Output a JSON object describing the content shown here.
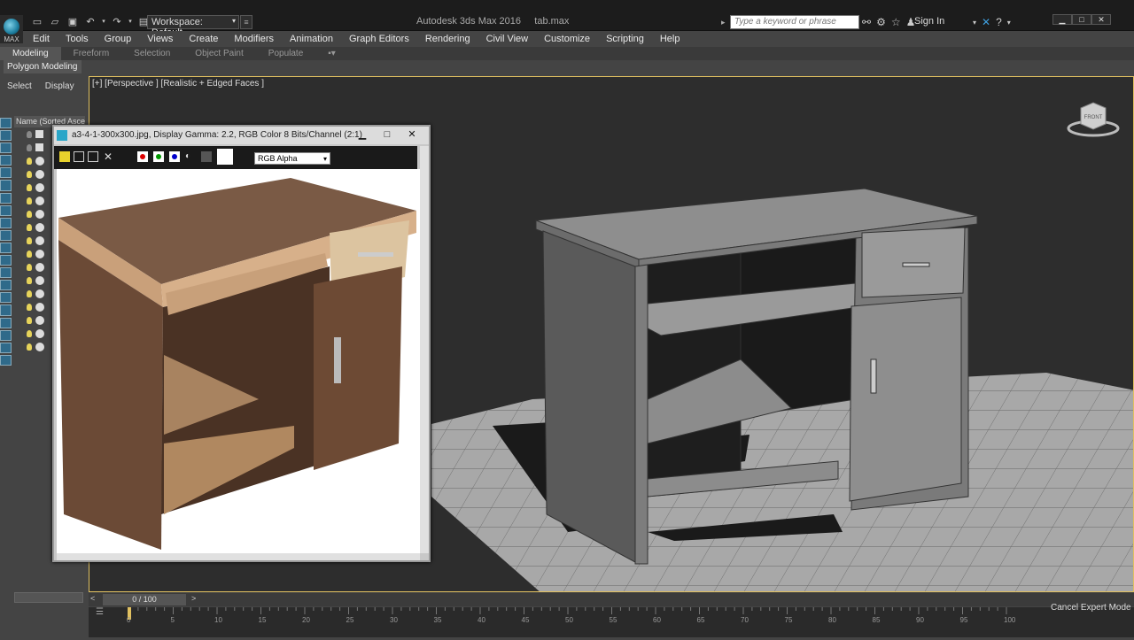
{
  "app": {
    "title": "Autodesk 3ds Max 2016     tab.max",
    "logo_text": "MAX",
    "workspace": "Workspace: Default",
    "search_placeholder": "Type a keyword or phrase",
    "sign_in": "Sign In"
  },
  "menu": [
    "Edit",
    "Tools",
    "Group",
    "Views",
    "Create",
    "Modifiers",
    "Animation",
    "Graph Editors",
    "Rendering",
    "Civil View",
    "Customize",
    "Scripting",
    "Help"
  ],
  "ribbon": {
    "tabs": [
      "Modeling",
      "Freeform",
      "Selection",
      "Object Paint",
      "Populate"
    ],
    "active_tab": "Modeling",
    "panel_label": "Polygon Modeling"
  },
  "scene_explorer": {
    "tabs": [
      "Select",
      "Display"
    ],
    "column_header": "Name (Sorted Ascer"
  },
  "viewport": {
    "label": "[+] [Perspective ] [Realistic + Edged Faces ]",
    "viewcube_text": "FRONT"
  },
  "image_window": {
    "title": "a3-4-1-300x300.jpg, Display Gamma: 2.2, RGB Color 8 Bits/Channel (2:1)",
    "channel": "RGB Alpha"
  },
  "timeline": {
    "frame": "0 / 100",
    "ticks": [
      "0",
      "5",
      "10",
      "15",
      "20",
      "25",
      "30",
      "35",
      "40",
      "45",
      "50",
      "55",
      "60",
      "65",
      "70",
      "75",
      "80",
      "85",
      "90",
      "95",
      "100"
    ],
    "prev": "<",
    "next": ">"
  },
  "status": {
    "cancel_expert": "Cancel Expert Mode"
  }
}
